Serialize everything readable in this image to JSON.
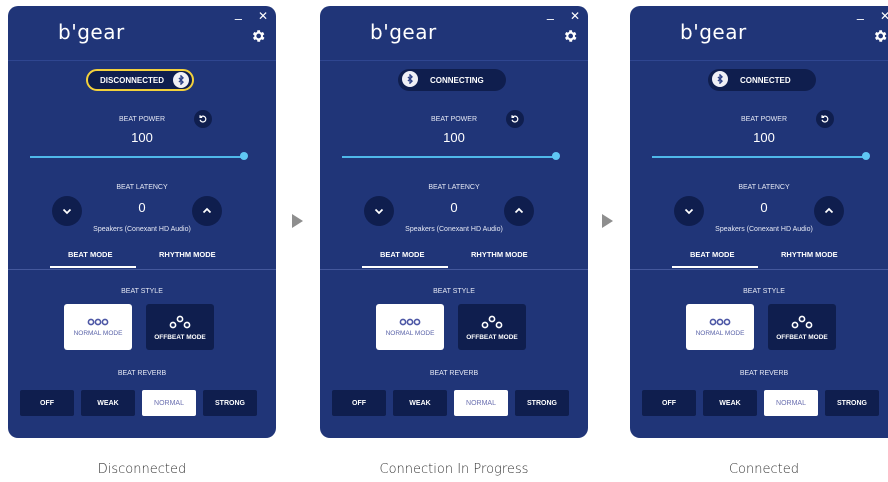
{
  "window": {
    "minimize_glyph": "–",
    "close_glyph": "✕"
  },
  "brand": "b'gear",
  "colors": {
    "panel": "#203578",
    "dark_button": "#0f1e4e",
    "accent": "#5fc7f3",
    "disconnected_ring": "#f3d13c"
  },
  "beat_power": {
    "label": "BEAT POWER",
    "value": "100",
    "level": 1.0
  },
  "beat_latency": {
    "label": "BEAT LATENCY",
    "value": "0",
    "device": "Speakers (Conexant HD Audio)"
  },
  "tabs": {
    "beat_mode": "BEAT MODE",
    "rhythm_mode": "RHYTHM MODE"
  },
  "beat_style": {
    "label": "BEAT STYLE",
    "normal": "NORMAL MODE",
    "offbeat": "OFFBEAT MODE"
  },
  "beat_reverb": {
    "label": "BEAT REVERB",
    "options": [
      "OFF",
      "WEAK",
      "NORMAL",
      "STRONG"
    ],
    "selected": "NORMAL"
  },
  "panels": [
    {
      "status": "DISCONNECTED",
      "caption": "Disconnected"
    },
    {
      "status": "CONNECTING",
      "caption": "Connection In Progress"
    },
    {
      "status": "CONNECTED",
      "caption": "Connected"
    }
  ],
  "icons": {
    "settings": "gear-icon",
    "reset": "reset-icon",
    "down": "chevron-down-icon",
    "up": "chevron-up-icon",
    "bluetooth": "bluetooth-icon"
  }
}
